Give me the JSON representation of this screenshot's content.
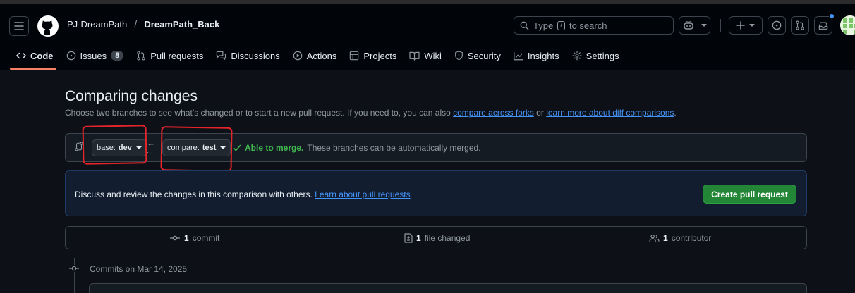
{
  "header": {
    "owner": "PJ-DreamPath",
    "separator": "/",
    "repo": "DreamPath_Back",
    "search_prefix": "Type",
    "search_key": "/",
    "search_suffix": "to search"
  },
  "tabs": [
    {
      "label": "Code",
      "active": true
    },
    {
      "label": "Issues",
      "count": "8"
    },
    {
      "label": "Pull requests"
    },
    {
      "label": "Discussions"
    },
    {
      "label": "Actions"
    },
    {
      "label": "Projects"
    },
    {
      "label": "Wiki"
    },
    {
      "label": "Security"
    },
    {
      "label": "Insights"
    },
    {
      "label": "Settings"
    }
  ],
  "page": {
    "title": "Comparing changes",
    "subtitle_pre": "Choose two branches to see what’s changed or to start a new pull request. If you need to, you can also",
    "subtitle_link1": "compare across forks",
    "subtitle_mid": "or",
    "subtitle_link2": "learn more about diff comparisons",
    "subtitle_end": "."
  },
  "compare": {
    "base_prefix": "base:",
    "base_branch": "dev",
    "compare_prefix": "compare:",
    "compare_branch": "test",
    "merge_status": "Able to merge.",
    "merge_detail": "These branches can be automatically merged."
  },
  "flash": {
    "text": "Discuss and review the changes in this comparison with others.",
    "link": "Learn about pull requests",
    "button": "Create pull request"
  },
  "stats": {
    "commits_count": "1",
    "commits_label": "commit",
    "files_count": "1",
    "files_label": "file changed",
    "contributors_count": "1",
    "contributors_label": "contributor"
  },
  "commits": {
    "date_heading": "Commits on Mar 14, 2025"
  },
  "colors": {
    "accent_green": "#238636",
    "link_blue": "#4493f8",
    "annotation_red": "#e5252a",
    "tab_underline": "#f78166"
  }
}
